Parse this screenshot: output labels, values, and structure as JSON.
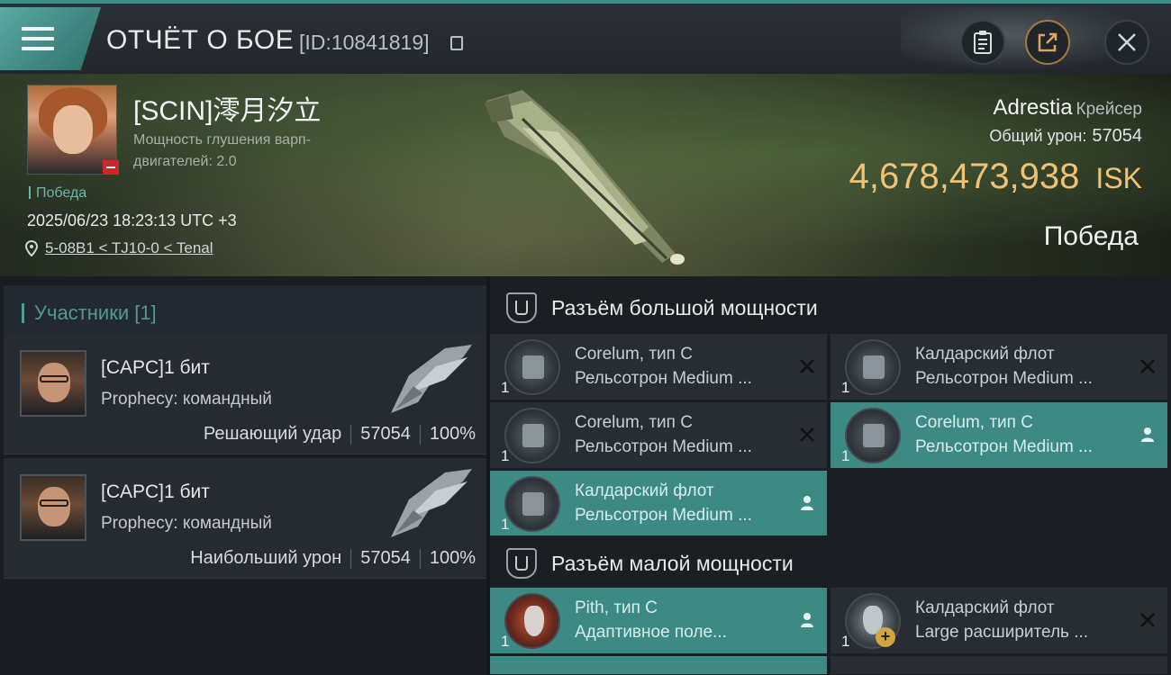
{
  "header": {
    "title": "ОТЧЁТ О БОЕ",
    "report_id": "[ID:10841819]"
  },
  "victim": {
    "name": "[SCIN]澪月汐立",
    "attribute": "Мощность глушения варп-двигателей: 2.0",
    "status": "Победа",
    "datetime": "2025/06/23 18:23:13 UTC +3",
    "location": "5-08B1 < TJ10-0 < Tenal",
    "ship_name": "Adrestia",
    "ship_class": "Крейсер",
    "total_damage_label": "Общий урон:",
    "total_damage": "57054",
    "isk_value": "4,678,473,938",
    "isk_unit": "ISK",
    "result": "Победа"
  },
  "participants": {
    "header": "Участники [1]",
    "list": [
      {
        "name": "[CAPC]1 бит",
        "ship": "Prophecy: командный",
        "role": "Решающий удар",
        "damage": "57054",
        "percent": "100%"
      },
      {
        "name": "[CAPC]1 бит",
        "ship": "Prophecy: командный",
        "role": "Наибольший урон",
        "damage": "57054",
        "percent": "100%"
      }
    ]
  },
  "high_slots": {
    "title": "Разъём большой мощности",
    "modules": [
      {
        "qty": "1",
        "line1": "Corelum, тип C",
        "line2": "Рельсотрон Medium ...",
        "state": "destroyed"
      },
      {
        "qty": "1",
        "line1": "Калдарский флот",
        "line2": "Рельсотрон Medium ...",
        "state": "destroyed"
      },
      {
        "qty": "1",
        "line1": "Corelum, тип C",
        "line2": "Рельсотрон Medium ...",
        "state": "destroyed"
      },
      {
        "qty": "1",
        "line1": "Corelum, тип C",
        "line2": "Рельсотрон Medium ...",
        "state": "dropped"
      },
      {
        "qty": "1",
        "line1": "Калдарский флот",
        "line2": "Рельсотрон Medium ...",
        "state": "dropped"
      }
    ]
  },
  "low_slots": {
    "title": "Разъём малой мощности",
    "modules": [
      {
        "qty": "1",
        "line1": "Pith, тип C",
        "line2": "Адаптивное поле...",
        "state": "dropped"
      },
      {
        "qty": "1",
        "line1": "Калдарский флот",
        "line2": "Large расширитель ...",
        "state": "destroyed"
      }
    ]
  },
  "colors": {
    "accent": "#3d8a85",
    "isk": "#f0c276",
    "panel": "#272d33"
  }
}
